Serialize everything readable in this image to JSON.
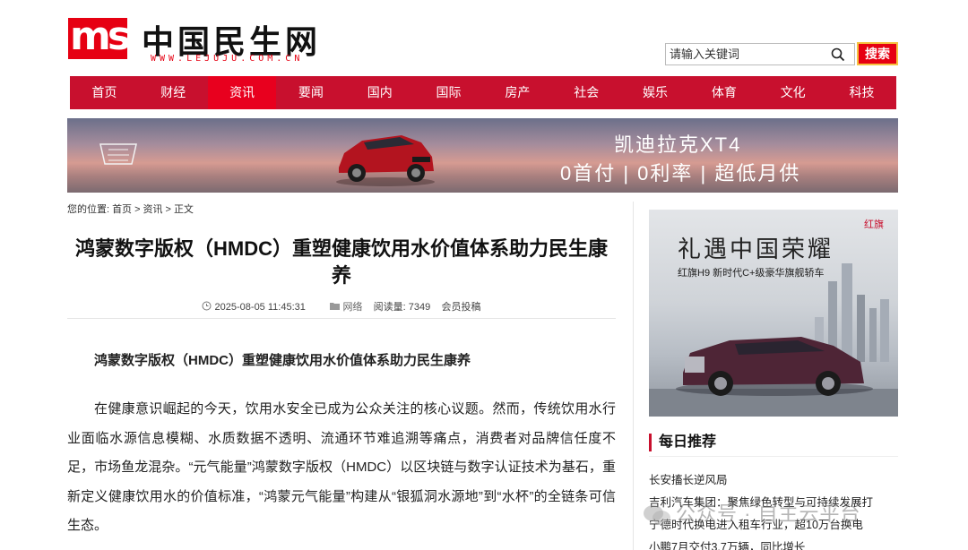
{
  "site": {
    "logo_mark": "ms",
    "name_cn": "中国民生网",
    "name_en": "WWW.LEJUJU.COM.CN"
  },
  "search": {
    "placeholder": "请输入关键词",
    "button": "搜索"
  },
  "nav": [
    {
      "label": "首页"
    },
    {
      "label": "财经"
    },
    {
      "label": "资讯",
      "active": true
    },
    {
      "label": "要闻"
    },
    {
      "label": "国内"
    },
    {
      "label": "国际"
    },
    {
      "label": "房产"
    },
    {
      "label": "社会"
    },
    {
      "label": "娱乐"
    },
    {
      "label": "体育"
    },
    {
      "label": "文化"
    },
    {
      "label": "科技"
    }
  ],
  "banner": {
    "line1": "凯迪拉克XT4",
    "line2": "0首付 | 0利率 | 超低月供"
  },
  "breadcrumb": {
    "prefix": "您的位置:",
    "items": [
      "首页",
      ">",
      "资讯",
      ">",
      "正文"
    ]
  },
  "article": {
    "title": "鸿蒙数字版权（HMDC）重塑健康饮用水价值体系助力民生康养",
    "datetime": "2025-08-05 11:45:31",
    "source": "网络",
    "views_label": "阅读量:",
    "views": "7349",
    "contributor": "会员投稿",
    "subhead": "鸿蒙数字版权（HMDC）重塑健康饮用水价值体系助力民生康养",
    "paragraph": "在健康意识崛起的今天，饮用水安全已成为公众关注的核心议题。然而，传统饮用水行业面临水源信息模糊、水质数据不透明、流通环节难追溯等痛点，消费者对品牌信任度不足，市场鱼龙混杂。“元气能量”鸿蒙数字版权（HMDC）以区块链与数字认证技术为基石，重新定义健康饮用水的价值标准，“鸿蒙元气能量”构建从“银狐洞水源地”到“水杯”的全链条可信生态。"
  },
  "ad": {
    "brand": "红旗",
    "slogan": "礼遇中国荣耀",
    "sub": "红旗H9 新时代C+级豪华旗舰轿车"
  },
  "recommend": {
    "title": "每日推荐",
    "items": [
      "长安搐长逆风局",
      "吉利汽车集团：聚焦绿色转型与可持续发展打",
      "宁德时代换电进入租车行业，超10万台换电",
      "小鹏7月交付3.7万辆，同比增长"
    ]
  },
  "watermark": "公众号 · 自主云平台",
  "colors": {
    "brand_red": "#e60012",
    "nav_red": "#c8102e",
    "active_red": "#e8001e"
  }
}
